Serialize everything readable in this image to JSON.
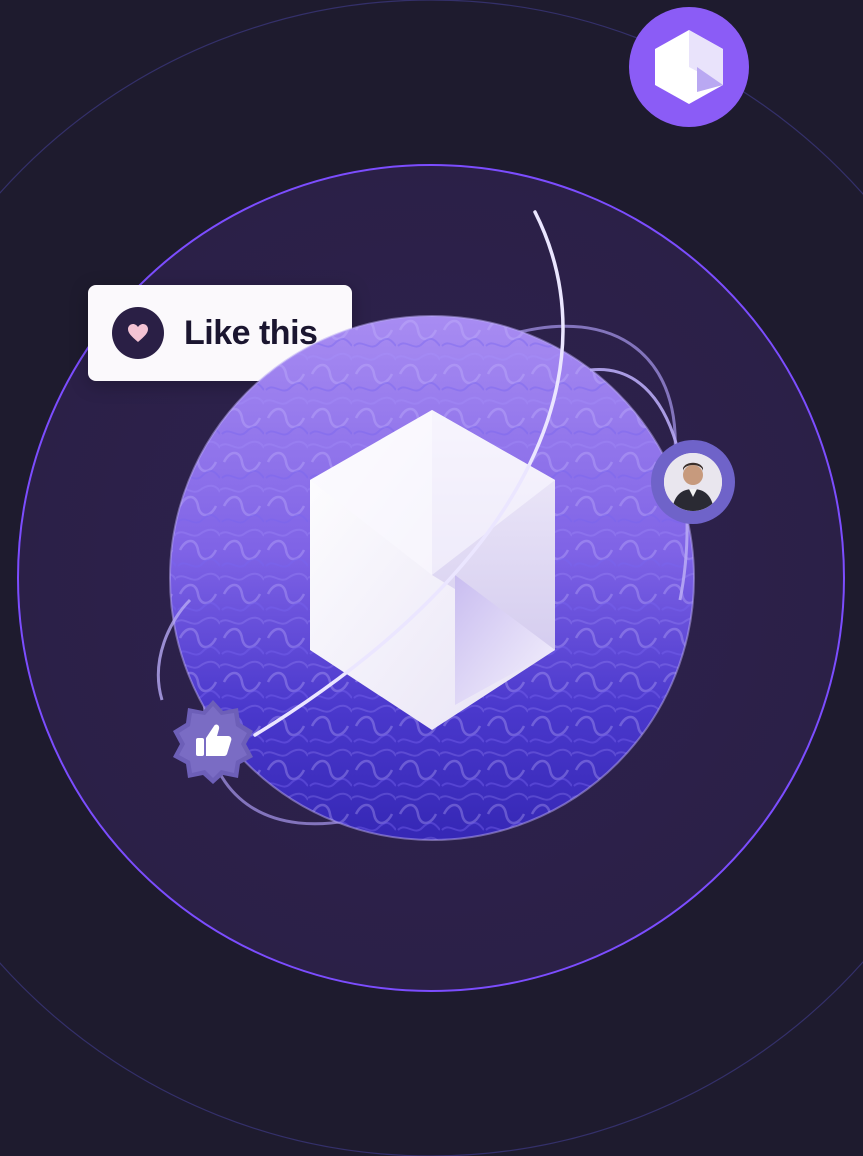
{
  "like_card": {
    "label": "Like this",
    "icon": "heart-icon"
  },
  "logo": {
    "icon": "hexagon-logo-icon"
  },
  "avatar": {
    "icon": "user-avatar"
  },
  "thumbs_badge": {
    "icon": "thumbs-up-icon"
  },
  "colors": {
    "background": "#1e1b2e",
    "inner_circle": "#2c2148",
    "accent": "#8b5cf6",
    "ring": "#7c4dff",
    "card": "#fbf9fc"
  }
}
